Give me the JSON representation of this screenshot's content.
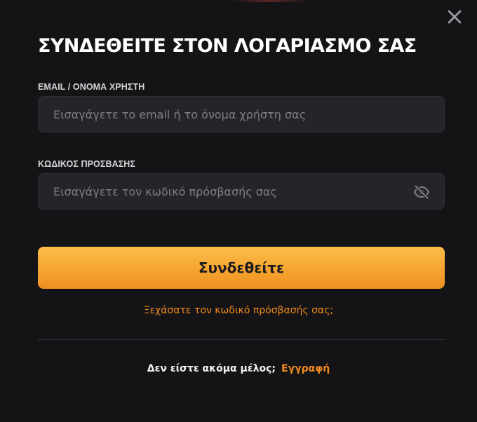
{
  "dialog": {
    "title": "ΣΥΝΔΕΘΕΙΤΕ ΣΤΟΝ ΛΟΓΑΡΙΑΣΜΟ ΣΑΣ",
    "close_icon": "close-icon"
  },
  "email": {
    "label": "EMAIL / ΟΝΟΜΑ ΧΡΗΣΤΗ",
    "placeholder": "Εισαγάγετε το email ή το όνομα χρήστη σας",
    "value": ""
  },
  "password": {
    "label": "ΚΩΔΙΚΟΣ ΠΡΟΣΒΑΣΗΣ",
    "placeholder": "Εισαγάγετε τον κωδικό πρόσβασής σας",
    "value": "",
    "toggle_icon": "eye-slash-icon"
  },
  "actions": {
    "submit_label": "Συνδεθείτε",
    "forgot_label": "Ξεχάσατε τον κωδικό πρόσβασής σας;",
    "signup_question": "Δεν είστε ακόμα μέλος;",
    "signup_label": "Εγγραφή"
  },
  "colors": {
    "background": "#141416",
    "field_background": "#24252b",
    "accent": "#f28a1e",
    "button_gradient_top": "#fbbd49",
    "button_gradient_bottom": "#ee8f1f",
    "title_text": "#ffffff"
  }
}
